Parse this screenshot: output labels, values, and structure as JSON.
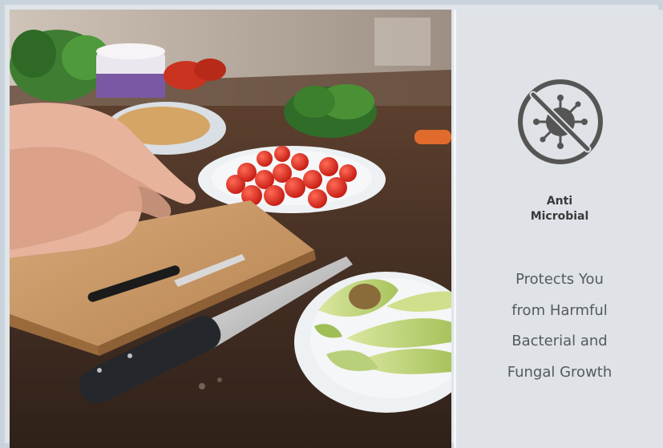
{
  "feature": {
    "icon": "anti-microbial-icon",
    "title_lines": [
      "Anti",
      "Microbial"
    ],
    "description_lines": [
      "Protects You",
      "from Harmful",
      "Bacterial and",
      "Fungal Growth"
    ]
  },
  "photo": {
    "subject": "kitchen-prep-photo"
  },
  "colors": {
    "panel_bg": "#dfe2e6",
    "frame_border": "#c9d3dc",
    "icon_stroke": "#555555",
    "title_text": "#3a3a3a",
    "body_text": "#555a5f"
  }
}
